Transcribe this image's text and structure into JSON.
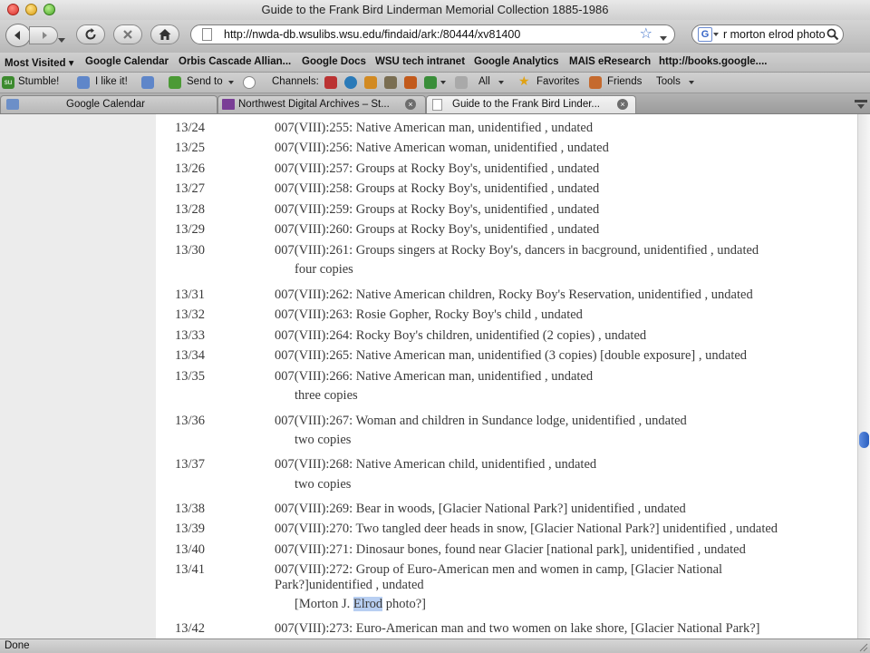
{
  "window": {
    "title": "Guide to the Frank Bird Linderman Memorial Collection 1885-1986"
  },
  "nav": {
    "url": "http://nwda-db.wsulibs.wsu.edu/findaid/ark:/80444/xv81400",
    "search": "r morton elrod photo"
  },
  "bookmarks": [
    {
      "label": "Most Visited ▾"
    },
    {
      "label": "Google Calendar"
    },
    {
      "label": "Orbis Cascade Allian..."
    },
    {
      "label": "Google Docs"
    },
    {
      "label": "WSU tech intranet"
    },
    {
      "label": "Google Analytics"
    },
    {
      "label": "MAIS eResearch"
    },
    {
      "label": "http://books.google...."
    }
  ],
  "ext": {
    "stumble": "Stumble!",
    "like": "I like it!",
    "sendto": "Send to",
    "channels": "Channels:",
    "all": "All",
    "favorites": "Favorites",
    "friends": "Friends",
    "tools": "Tools"
  },
  "tabs": [
    {
      "label": "Google Calendar"
    },
    {
      "label": "Northwest Digital Archives – St..."
    },
    {
      "label": "Guide to the Frank Bird Linder..."
    }
  ],
  "rows": [
    {
      "box": "13/24",
      "desc": "007(VIII):255: Native American man, unidentified , undated"
    },
    {
      "box": "13/25",
      "desc": "007(VIII):256: Native American woman, unidentified , undated"
    },
    {
      "box": "13/26",
      "desc": "007(VIII):257: Groups at Rocky Boy's, unidentified , undated"
    },
    {
      "box": "13/27",
      "desc": "007(VIII):258: Groups at Rocky Boy's, unidentified , undated"
    },
    {
      "box": "13/28",
      "desc": "007(VIII):259: Groups at Rocky Boy's, unidentified , undated"
    },
    {
      "box": "13/29",
      "desc": "007(VIII):260: Groups at Rocky Boy's, unidentified , undated"
    },
    {
      "box": "13/30",
      "desc": "007(VIII):261: Groups singers at Rocky Boy's, dancers in bacground, unidentified , undated",
      "note": "four copies"
    },
    {
      "box": "13/31",
      "desc": "007(VIII):262: Native American children, Rocky Boy's Reservation, unidentified , undated"
    },
    {
      "box": "13/32",
      "desc": "007(VIII):263: Rosie Gopher, Rocky Boy's child , undated"
    },
    {
      "box": "13/33",
      "desc": "007(VIII):264: Rocky Boy's children, unidentified (2 copies) , undated"
    },
    {
      "box": "13/34",
      "desc": "007(VIII):265: Native American man, unidentified (3 copies) [double exposure] , undated"
    },
    {
      "box": "13/35",
      "desc": "007(VIII):266: Native American man, unidentified , undated",
      "note": "three copies"
    },
    {
      "box": "13/36",
      "desc": "007(VIII):267: Woman and children in Sundance lodge, unidentified , undated",
      "note": "two copies"
    },
    {
      "box": "13/37",
      "desc": "007(VIII):268: Native American child, unidentified , undated",
      "note": "two copies"
    },
    {
      "box": "13/38",
      "desc": "007(VIII):269: Bear in woods, [Glacier National Park?] unidentified , undated"
    },
    {
      "box": "13/39",
      "desc": "007(VIII):270: Two tangled deer heads in snow, [Glacier National Park?] unidentified , undated"
    },
    {
      "box": "13/40",
      "desc": "007(VIII):271: Dinosaur bones, found near Glacier [national park], unidentified , undated"
    },
    {
      "box": "13/41",
      "desc": "007(VIII):272: Group of Euro-American men and women in camp, [Glacier National Park?]unidentified , undated"
    },
    {
      "box": "13/42",
      "desc": "007(VIII):273: Euro-American man and two women on lake shore, [Glacier National Park?]"
    }
  ],
  "note_13_41": {
    "before": "[Morton J. ",
    "highlight": "Elrod",
    "after": " photo?]"
  },
  "status": {
    "text": "Done"
  }
}
